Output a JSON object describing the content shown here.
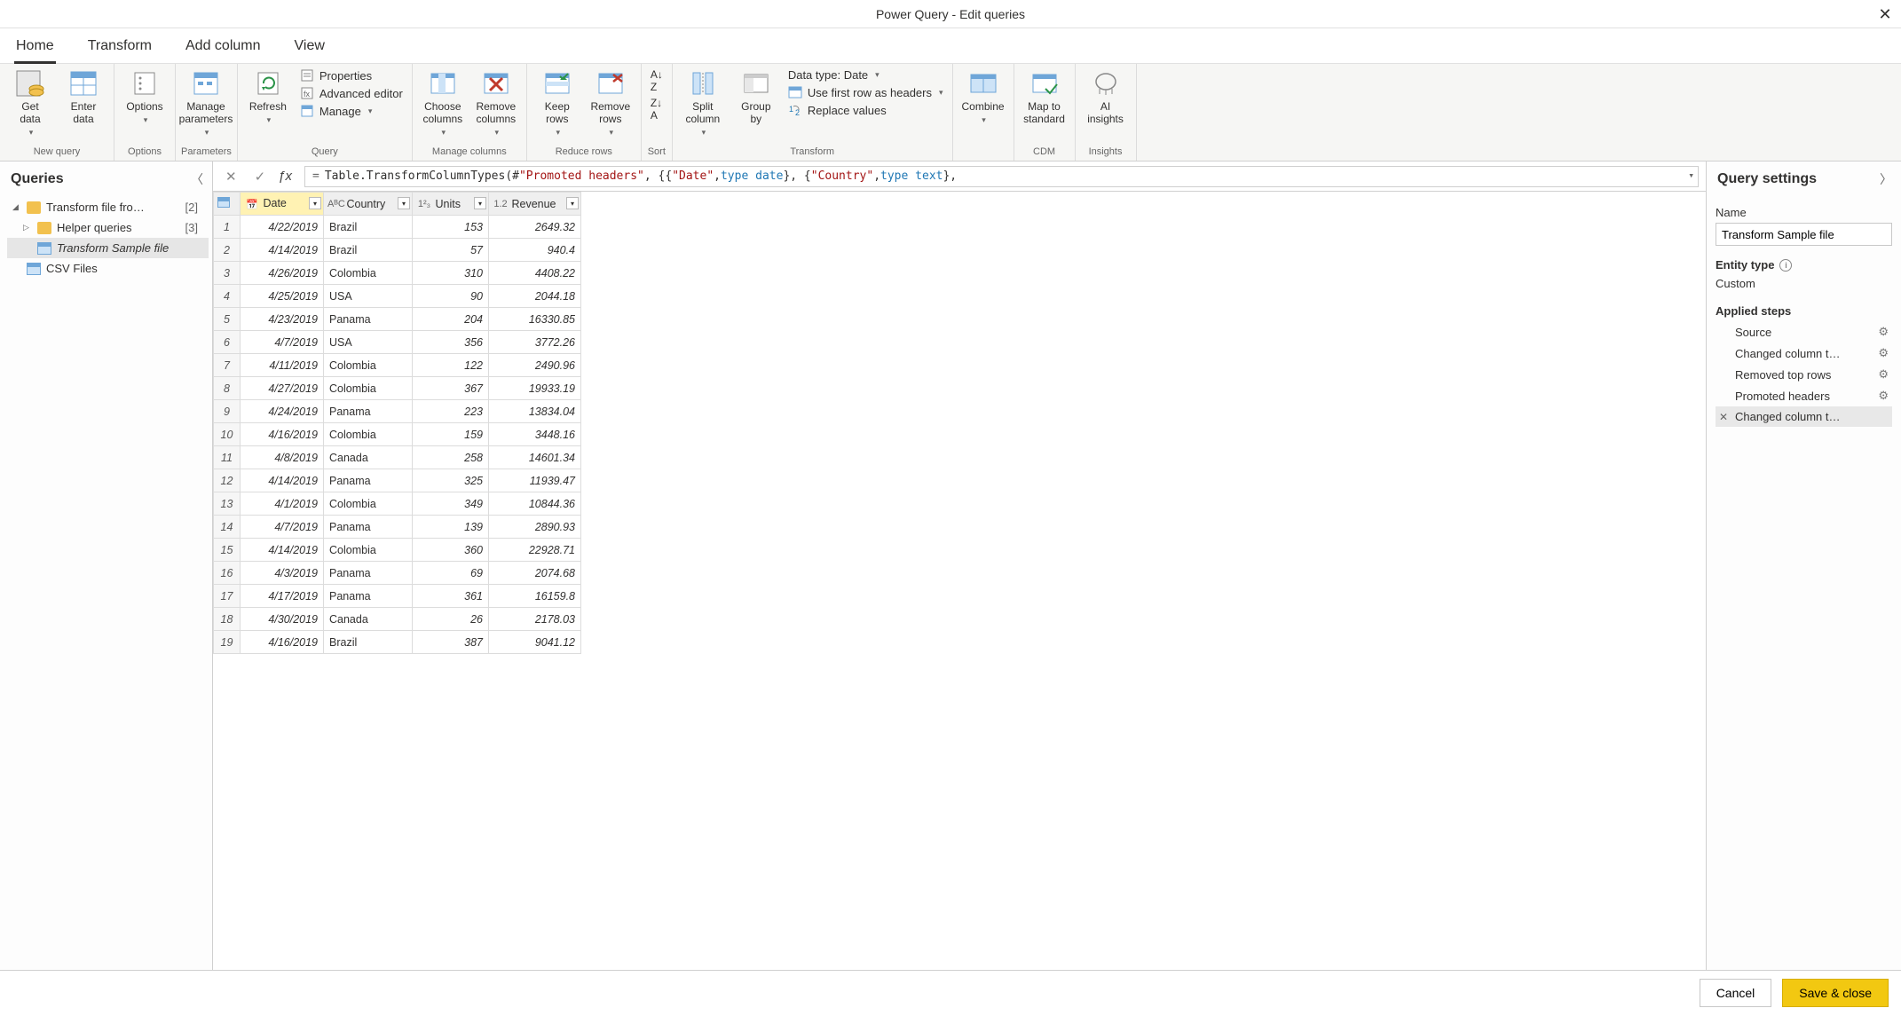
{
  "window": {
    "title": "Power Query - Edit queries",
    "close": "✕"
  },
  "tabs": [
    "Home",
    "Transform",
    "Add column",
    "View"
  ],
  "active_tab": 0,
  "ribbon": {
    "groups": [
      {
        "label": "New query",
        "items": [
          {
            "label": "Get\ndata",
            "icon": "db",
            "dd": true
          },
          {
            "label": "Enter\ndata",
            "icon": "table",
            "dd": false
          }
        ]
      },
      {
        "label": "Options",
        "items": [
          {
            "label": "Options",
            "icon": "options",
            "dd": true
          }
        ]
      },
      {
        "label": "Parameters",
        "items": [
          {
            "label": "Manage\nparameters",
            "icon": "param",
            "dd": true
          }
        ]
      },
      {
        "label": "Query",
        "big": {
          "label": "Refresh",
          "icon": "refresh",
          "dd": true
        },
        "mini": [
          {
            "label": "Properties",
            "icon": "prop"
          },
          {
            "label": "Advanced editor",
            "icon": "adv"
          },
          {
            "label": "Manage",
            "icon": "manage",
            "dd": true
          }
        ]
      },
      {
        "label": "Manage columns",
        "items": [
          {
            "label": "Choose\ncolumns",
            "icon": "choosecol",
            "dd": true
          },
          {
            "label": "Remove\ncolumns",
            "icon": "removecol",
            "dd": true
          }
        ]
      },
      {
        "label": "Reduce rows",
        "items": [
          {
            "label": "Keep\nrows",
            "icon": "keeprow",
            "dd": true
          },
          {
            "label": "Remove\nrows",
            "icon": "removerow",
            "dd": true
          }
        ]
      },
      {
        "label": "Sort",
        "sort": true
      },
      {
        "label": "Transform",
        "items": [
          {
            "label": "Split\ncolumn",
            "icon": "split",
            "dd": true
          },
          {
            "label": "Group\nby",
            "icon": "group",
            "dd": false
          }
        ],
        "mini": [
          {
            "label": "Data type: Date",
            "icon": "",
            "dd": true
          },
          {
            "label": "Use first row as headers",
            "icon": "headerrow",
            "dd": true
          },
          {
            "label": "Replace values",
            "icon": "replace"
          }
        ]
      },
      {
        "label": "",
        "items": [
          {
            "label": "Combine",
            "icon": "combine",
            "dd": true
          }
        ]
      },
      {
        "label": "CDM",
        "items": [
          {
            "label": "Map to\nstandard",
            "icon": "cdm",
            "dd": false
          }
        ]
      },
      {
        "label": "Insights",
        "items": [
          {
            "label": "AI\ninsights",
            "icon": "ai",
            "dd": false
          }
        ]
      }
    ]
  },
  "queries": {
    "title": "Queries",
    "items": [
      {
        "label": "Transform file fro…",
        "count": "[2]",
        "type": "folder",
        "expanded": true,
        "indent": 0
      },
      {
        "label": "Helper queries",
        "count": "[3]",
        "type": "folder",
        "expanded": false,
        "indent": 1
      },
      {
        "label": "Transform Sample file",
        "type": "query",
        "indent": 1,
        "selected": true
      },
      {
        "label": "CSV Files",
        "type": "query",
        "indent": 0
      }
    ]
  },
  "formula_prefix": "=",
  "formula": "Table.TransformColumnTypes(#\"Promoted headers\", {{\"Date\", type date}, {\"Country\", type text},",
  "columns": [
    {
      "name": "Date",
      "type": "date",
      "selected": true,
      "type_glyph": "📅"
    },
    {
      "name": "Country",
      "type": "text",
      "type_glyph": "AᴮC"
    },
    {
      "name": "Units",
      "type": "int",
      "type_glyph": "1²₃"
    },
    {
      "name": "Revenue",
      "type": "decimal",
      "type_glyph": "1.2"
    }
  ],
  "rows": [
    {
      "n": 1,
      "date": "4/22/2019",
      "country": "Brazil",
      "units": 153,
      "revenue": "2649.32"
    },
    {
      "n": 2,
      "date": "4/14/2019",
      "country": "Brazil",
      "units": 57,
      "revenue": "940.4"
    },
    {
      "n": 3,
      "date": "4/26/2019",
      "country": "Colombia",
      "units": 310,
      "revenue": "4408.22"
    },
    {
      "n": 4,
      "date": "4/25/2019",
      "country": "USA",
      "units": 90,
      "revenue": "2044.18"
    },
    {
      "n": 5,
      "date": "4/23/2019",
      "country": "Panama",
      "units": 204,
      "revenue": "16330.85"
    },
    {
      "n": 6,
      "date": "4/7/2019",
      "country": "USA",
      "units": 356,
      "revenue": "3772.26"
    },
    {
      "n": 7,
      "date": "4/11/2019",
      "country": "Colombia",
      "units": 122,
      "revenue": "2490.96"
    },
    {
      "n": 8,
      "date": "4/27/2019",
      "country": "Colombia",
      "units": 367,
      "revenue": "19933.19"
    },
    {
      "n": 9,
      "date": "4/24/2019",
      "country": "Panama",
      "units": 223,
      "revenue": "13834.04"
    },
    {
      "n": 10,
      "date": "4/16/2019",
      "country": "Colombia",
      "units": 159,
      "revenue": "3448.16"
    },
    {
      "n": 11,
      "date": "4/8/2019",
      "country": "Canada",
      "units": 258,
      "revenue": "14601.34"
    },
    {
      "n": 12,
      "date": "4/14/2019",
      "country": "Panama",
      "units": 325,
      "revenue": "11939.47"
    },
    {
      "n": 13,
      "date": "4/1/2019",
      "country": "Colombia",
      "units": 349,
      "revenue": "10844.36"
    },
    {
      "n": 14,
      "date": "4/7/2019",
      "country": "Panama",
      "units": 139,
      "revenue": "2890.93"
    },
    {
      "n": 15,
      "date": "4/14/2019",
      "country": "Colombia",
      "units": 360,
      "revenue": "22928.71"
    },
    {
      "n": 16,
      "date": "4/3/2019",
      "country": "Panama",
      "units": 69,
      "revenue": "2074.68"
    },
    {
      "n": 17,
      "date": "4/17/2019",
      "country": "Panama",
      "units": 361,
      "revenue": "16159.8"
    },
    {
      "n": 18,
      "date": "4/30/2019",
      "country": "Canada",
      "units": 26,
      "revenue": "2178.03"
    },
    {
      "n": 19,
      "date": "4/16/2019",
      "country": "Brazil",
      "units": 387,
      "revenue": "9041.12"
    }
  ],
  "settings": {
    "title": "Query settings",
    "name_label": "Name",
    "name_value": "Transform Sample file",
    "entity_label": "Entity type",
    "entity_value": "Custom",
    "steps_label": "Applied steps",
    "steps": [
      {
        "label": "Source",
        "gear": true
      },
      {
        "label": "Changed column t…",
        "gear": true
      },
      {
        "label": "Removed top rows",
        "gear": true
      },
      {
        "label": "Promoted headers",
        "gear": true
      },
      {
        "label": "Changed column t…",
        "gear": false,
        "selected": true,
        "deletable": true
      }
    ]
  },
  "footer": {
    "cancel": "Cancel",
    "save": "Save & close"
  }
}
